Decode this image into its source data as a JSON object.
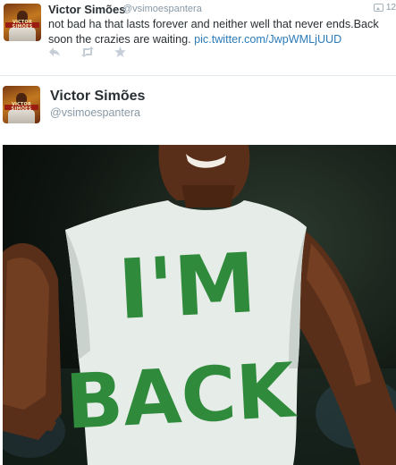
{
  "top_tweet": {
    "author_name": "Victor Simões",
    "author_handle": "@vsimoespantera",
    "time": "12",
    "text_prefix": "not bad ha that lasts forever and neither well that never ends.Back soon the crazies are waiting. ",
    "link": "pic.twitter.com/JwpWMLjUUD",
    "actions": {
      "reply_icon": "reply-icon",
      "retweet_icon": "retweet-icon",
      "favorite_icon": "favorite-icon"
    }
  },
  "main_tweet": {
    "author_name": "Victor Simões",
    "author_handle": "@vsimoespantera",
    "photo": {
      "shirt_text_line1": "I'M",
      "shirt_text_line2": "BACK"
    }
  },
  "avatar": {
    "tag_text": "VICTOR SIMÕES"
  },
  "colors": {
    "link": "#2b7bb9",
    "muted": "#8899a6",
    "shirt_print": "#2f8a3b"
  }
}
